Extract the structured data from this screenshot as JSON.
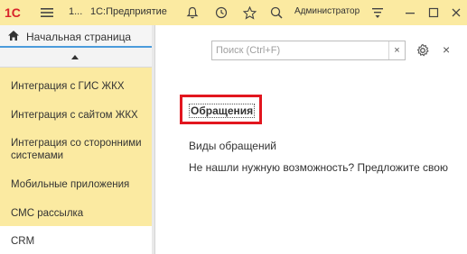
{
  "titlebar": {
    "logo": "1С",
    "tab_number": "1...",
    "app_title": "1С:Предприятие",
    "user": "Администратор",
    "icons": [
      "menu-icon",
      "bell-icon",
      "history-icon",
      "star-icon",
      "search-icon",
      "settings-funnel-icon",
      "minimize-icon",
      "maximize-icon",
      "close-icon"
    ]
  },
  "home_tab": {
    "label": "Начальная страница",
    "icon": "home-icon"
  },
  "sidebar": {
    "items": [
      {
        "label": "Интеграция с ГИС ЖКХ"
      },
      {
        "label": "Интеграция с сайтом ЖКХ"
      },
      {
        "label": "Интеграция со сторонними системами"
      },
      {
        "label": "Мобильные приложения"
      },
      {
        "label": "СМС рассылка"
      },
      {
        "label": "CRM"
      }
    ]
  },
  "main": {
    "search": {
      "placeholder": "Поиск (Ctrl+F)",
      "clear": "×"
    },
    "close": "×",
    "group_title": "Обращения",
    "links": [
      {
        "label": "Виды обращений"
      },
      {
        "label": "Не нашли нужную возможность? Предложите свою"
      }
    ]
  },
  "colors": {
    "sidebar_bg": "#fbeaa1",
    "highlight_border": "#e2161f",
    "tab_underline": "#4b9bdb"
  }
}
